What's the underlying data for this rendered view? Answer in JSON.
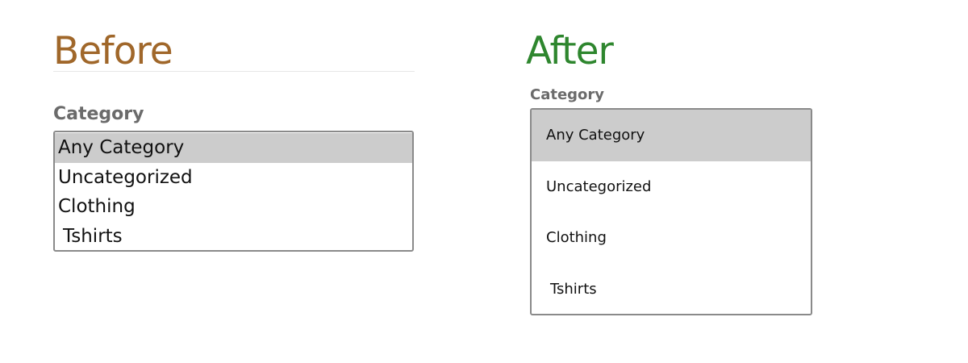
{
  "colors": {
    "before_title": "#a0672a",
    "after_title": "#2e862e",
    "label": "#6b6b6b",
    "selected_bg": "#cccccc",
    "border": "#8a8a8a"
  },
  "before": {
    "title": "Before",
    "label": "Category",
    "options": [
      "Any Category",
      "Uncategorized",
      "Clothing",
      "Tshirts"
    ],
    "selected": "Any Category"
  },
  "after": {
    "title": "After",
    "label": "Category",
    "options": [
      "Any Category",
      "Uncategorized",
      "Clothing",
      "Tshirts"
    ],
    "selected": "Any Category"
  }
}
